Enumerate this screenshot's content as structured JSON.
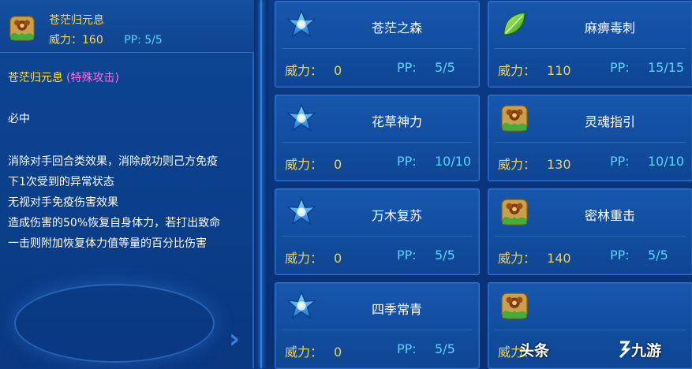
{
  "colors": {
    "panel_bg": "#0d4695",
    "card_bg": "#1657ad",
    "power_label": "#f3d24a",
    "pp_label": "#5ad6ff",
    "category": "#ff6be0",
    "skill_name": "#ffe14d"
  },
  "detail": {
    "icon": "grass-flower-icon",
    "title": "苍茫归元息",
    "power_text": "威力：160",
    "pp_text": "PP: 5/5",
    "name": "苍茫归元息",
    "category": "(特殊攻击)",
    "must_hit": "必中",
    "description": [
      "消除对手回合类效果，消除成功则己方免疫",
      "下1次受到的异常状态",
      "无视对手免疫伤害效果",
      "造成伤害的50%恢复自身体力，若打出致命",
      "一击则附加恢复体力值等量的百分比伤害"
    ]
  },
  "labels": {
    "power": "威力：",
    "pp": "PP:"
  },
  "skills": [
    {
      "name": "苍茫之森",
      "icon": "star-icon",
      "power": "0",
      "pp": "5/5"
    },
    {
      "name": "麻痹毒刺",
      "icon": "leaf-icon",
      "power": "110",
      "pp": "15/15"
    },
    {
      "name": "花草神力",
      "icon": "star-icon",
      "power": "0",
      "pp": "10/10"
    },
    {
      "name": "灵魂指引",
      "icon": "grass-flower-icon",
      "power": "130",
      "pp": "10/10"
    },
    {
      "name": "万木复苏",
      "icon": "star-icon",
      "power": "0",
      "pp": "5/5"
    },
    {
      "name": "密林重击",
      "icon": "grass-flower-icon",
      "power": "140",
      "pp": "5/5"
    },
    {
      "name": "四季常青",
      "icon": "star-icon",
      "power": "0",
      "pp": "5/5"
    },
    {
      "name": "",
      "icon": "grass-flower-icon",
      "power": "",
      "pp": ""
    }
  ],
  "watermarks": {
    "toutiao": "头条",
    "jiuyou": "九游"
  }
}
